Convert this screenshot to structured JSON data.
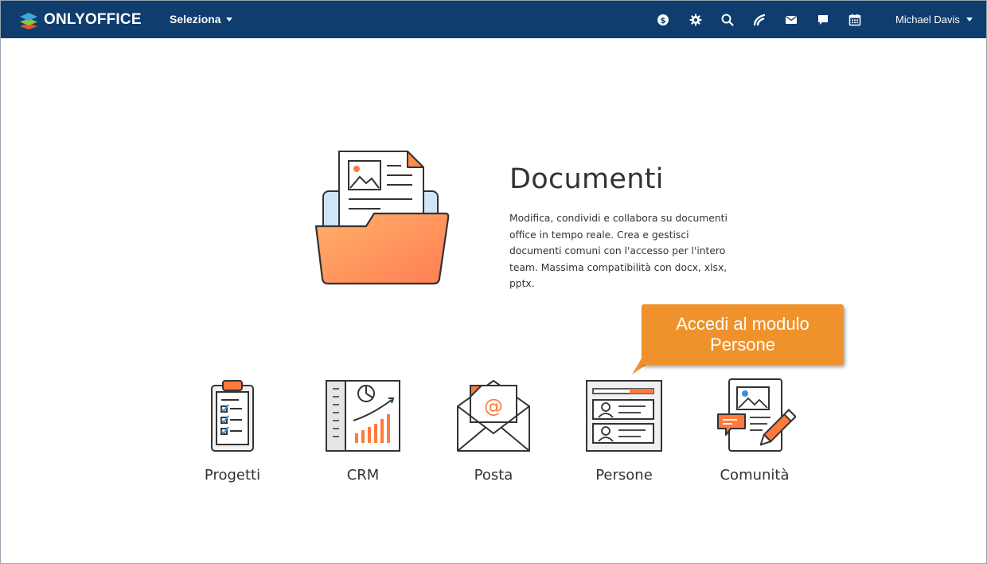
{
  "header": {
    "brand": "ONLYOFFICE",
    "module_selector": "Seleziona",
    "icons": [
      "payments-icon",
      "settings-icon",
      "search-icon",
      "feed-icon",
      "mail-icon",
      "chat-icon",
      "calendar-icon"
    ],
    "user_name": "Michael Davis",
    "colors": {
      "bar": "#0e3d6e"
    }
  },
  "hero": {
    "title": "Documenti",
    "description": "Modifica, condividi e collabora su documenti office in tempo reale. Crea e gestisci documenti comuni con l'accesso per l'intero team. Massima compatibilità con docx, xlsx, pptx."
  },
  "modules": [
    {
      "label": "Progetti"
    },
    {
      "label": "CRM"
    },
    {
      "label": "Posta"
    },
    {
      "label": "Persone"
    },
    {
      "label": "Comunità"
    }
  ],
  "tooltip": {
    "text": "Accedi al modulo Persone",
    "color": "#f0922b"
  }
}
